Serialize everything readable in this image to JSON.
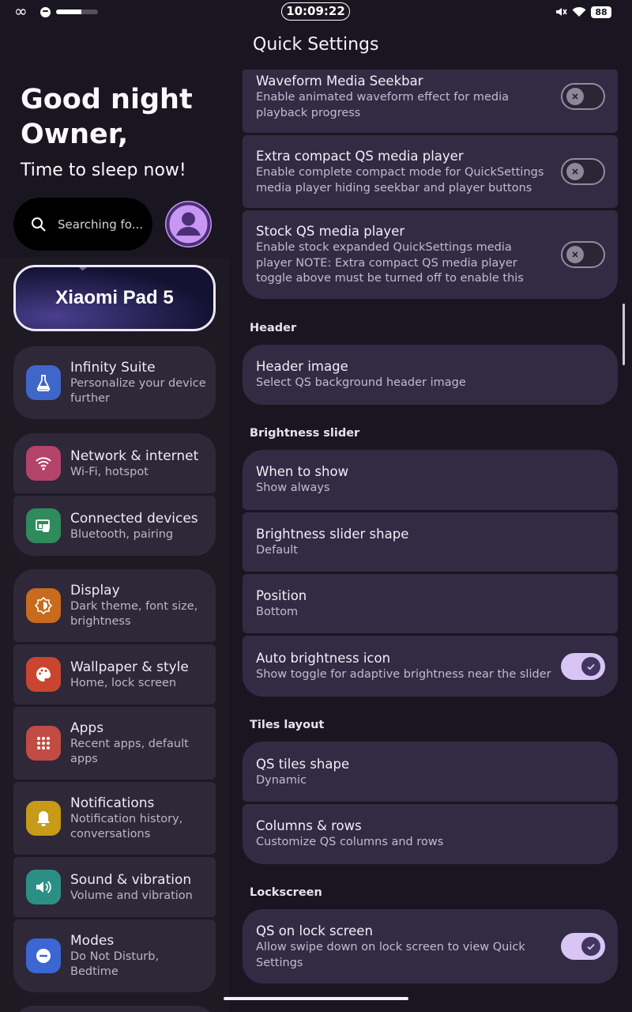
{
  "status_bar": {
    "clock": "10:09:22",
    "battery": "88",
    "media_progress": 0.6,
    "icons": [
      "infinity-icon",
      "spotify-icon",
      "mute-icon",
      "wifi-icon",
      "battery-icon"
    ]
  },
  "left": {
    "greeting_line1": "Good night",
    "greeting_line2": "Owner,",
    "sleep_message": "Time to sleep now!",
    "search_placeholder": "Searching fo...",
    "device_name": "Xiaomi Pad 5",
    "menu": [
      {
        "title": "Infinity Suite",
        "subtitle": "Personalize your device further",
        "icon": "flask-icon",
        "icon_color": "#3f67c9"
      },
      {
        "title": "Network & internet",
        "subtitle": "Wi-Fi, hotspot",
        "icon": "wifi-icon",
        "icon_color": "#b4436a"
      },
      {
        "title": "Connected devices",
        "subtitle": "Bluetooth, pairing",
        "icon": "devices-icon",
        "icon_color": "#2f8a5c"
      },
      {
        "title": "Display",
        "subtitle": "Dark theme, font size, brightness",
        "icon": "brightness-icon",
        "icon_color": "#c86b1e"
      },
      {
        "title": "Wallpaper & style",
        "subtitle": "Home, lock screen",
        "icon": "palette-icon",
        "icon_color": "#c9452f"
      },
      {
        "title": "Apps",
        "subtitle": "Recent apps, default apps",
        "icon": "apps-grid-icon",
        "icon_color": "#c24b43"
      },
      {
        "title": "Notifications",
        "subtitle": "Notification history, conversations",
        "icon": "bell-icon",
        "icon_color": "#c79a17"
      },
      {
        "title": "Sound & vibration",
        "subtitle": "Volume and vibration",
        "icon": "speaker-icon",
        "icon_color": "#2c8f86"
      },
      {
        "title": "Modes",
        "subtitle": "Do Not Disturb, Bedtime",
        "icon": "do-not-disturb-icon",
        "icon_color": "#3c66d1"
      }
    ]
  },
  "right": {
    "page_title": "Quick Settings",
    "cards": [
      {
        "title": "Waveform Media Seekbar",
        "subtitle": "Enable animated waveform effect for media playback progress",
        "toggle": false
      },
      {
        "title": "Extra compact QS media player",
        "subtitle": "Enable complete compact mode for QuickSettings media player hiding seekbar and player buttons",
        "toggle": false
      },
      {
        "title": "Stock QS media player",
        "subtitle": "Enable stock expanded QuickSettings media player NOTE: Extra compact QS media player toggle above must be turned off to enable this",
        "toggle": false
      },
      {
        "title": "Header image",
        "subtitle": "Select QS background header image"
      },
      {
        "title": "When to show",
        "subtitle": "Show always"
      },
      {
        "title": "Brightness slider shape",
        "subtitle": "Default"
      },
      {
        "title": "Position",
        "subtitle": "Bottom"
      },
      {
        "title": "Auto brightness icon",
        "subtitle": "Show toggle for adaptive brightness near the slider",
        "toggle": true
      },
      {
        "title": "QS tiles shape",
        "subtitle": "Dynamic"
      },
      {
        "title": "Columns & rows",
        "subtitle": "Customize QS columns and rows"
      },
      {
        "title": "QS on lock screen",
        "subtitle": "Allow swipe down on lock screen to view Quick Settings",
        "toggle": true
      }
    ],
    "sections": {
      "header": "Header",
      "brightness": "Brightness slider",
      "tiles": "Tiles layout",
      "lockscreen": "Lockscreen"
    }
  }
}
